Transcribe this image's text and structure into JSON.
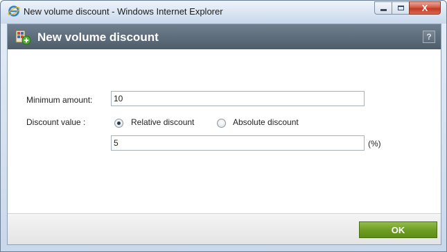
{
  "window": {
    "title": "New volume discount - Windows Internet Explorer",
    "close_label": "X"
  },
  "dialog": {
    "title": "New volume discount",
    "help_label": "?"
  },
  "form": {
    "minimum_amount_label": "Minimum amount:",
    "minimum_amount_value": "10",
    "discount_value_label": "Discount value :",
    "relative_discount_label": "Relative discount",
    "absolute_discount_label": "Absolute discount",
    "selected_discount_type": "Relative discount",
    "discount_value": "5",
    "discount_unit": "(%)"
  },
  "footer": {
    "ok_label": "OK"
  },
  "colors": {
    "header_bg": "#5d6b79",
    "ok_button": "#6f9e24",
    "close_button": "#c43a23"
  },
  "icons": {
    "browser": "internet-explorer-icon",
    "dialog": "volume-discount-icon"
  }
}
